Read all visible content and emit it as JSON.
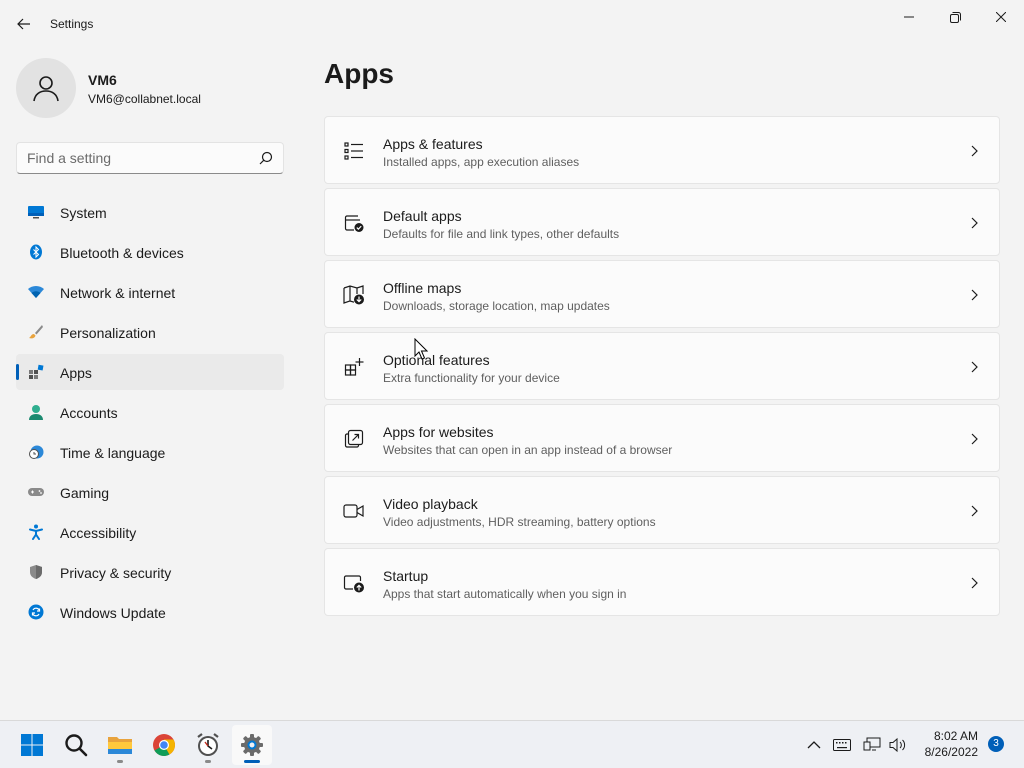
{
  "window": {
    "title": "Settings",
    "controls": [
      "minimize",
      "maximize",
      "close"
    ]
  },
  "user": {
    "name": "VM6",
    "email": "VM6@collabnet.local"
  },
  "search": {
    "placeholder": "Find a setting"
  },
  "nav": {
    "selected": "Apps",
    "items": [
      {
        "label": "System",
        "icon": "system-icon"
      },
      {
        "label": "Bluetooth & devices",
        "icon": "bluetooth-icon"
      },
      {
        "label": "Network & internet",
        "icon": "network-icon"
      },
      {
        "label": "Personalization",
        "icon": "brush-icon"
      },
      {
        "label": "Apps",
        "icon": "apps-icon"
      },
      {
        "label": "Accounts",
        "icon": "accounts-icon"
      },
      {
        "label": "Time & language",
        "icon": "clock-globe-icon"
      },
      {
        "label": "Gaming",
        "icon": "gamepad-icon"
      },
      {
        "label": "Accessibility",
        "icon": "accessibility-icon"
      },
      {
        "label": "Privacy & security",
        "icon": "shield-icon"
      },
      {
        "label": "Windows Update",
        "icon": "update-icon"
      }
    ]
  },
  "main": {
    "title": "Apps",
    "items": [
      {
        "title": "Apps & features",
        "desc": "Installed apps, app execution aliases",
        "icon": "list-icon"
      },
      {
        "title": "Default apps",
        "desc": "Defaults for file and link types, other defaults",
        "icon": "default-apps-icon"
      },
      {
        "title": "Offline maps",
        "desc": "Downloads, storage location, map updates",
        "icon": "map-download-icon"
      },
      {
        "title": "Optional features",
        "desc": "Extra functionality for your device",
        "icon": "optional-features-icon"
      },
      {
        "title": "Apps for websites",
        "desc": "Websites that can open in an app instead of a browser",
        "icon": "open-in-app-icon"
      },
      {
        "title": "Video playback",
        "desc": "Video adjustments, HDR streaming, battery options",
        "icon": "video-camera-icon"
      },
      {
        "title": "Startup",
        "desc": "Apps that start automatically when you sign in",
        "icon": "startup-icon"
      }
    ]
  },
  "taskbar": {
    "apps": [
      "start-icon",
      "search-icon",
      "file-explorer-icon",
      "chrome-icon",
      "alarm-clock-icon",
      "settings-gear-icon"
    ],
    "active": "settings-gear-icon",
    "time": "8:02 AM",
    "date": "8/26/2022",
    "notifications": "3"
  },
  "colors": {
    "accent": "#005fb8",
    "background": "#f3f3f3",
    "card": "#fbfbfb"
  }
}
